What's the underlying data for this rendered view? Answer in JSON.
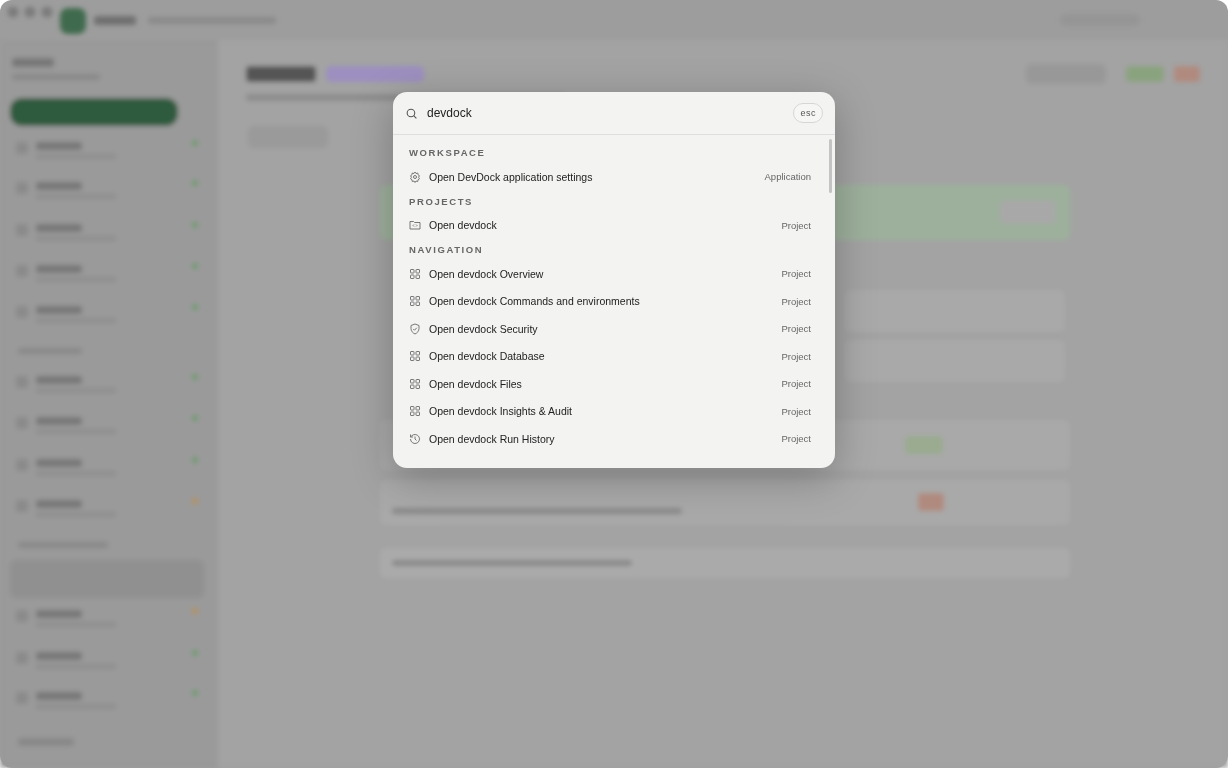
{
  "search": {
    "value": "devdock"
  },
  "esc_key": "esc",
  "sections": [
    {
      "title": "WORKSPACE",
      "items": [
        {
          "kind": "settings",
          "label": "Open DevDock application settings",
          "tag": "Application"
        }
      ]
    },
    {
      "title": "PROJECTS",
      "items": [
        {
          "kind": "folder",
          "label": "Open devdock",
          "tag": "Project"
        }
      ]
    },
    {
      "title": "NAVIGATION",
      "items": [
        {
          "kind": "page",
          "label": "Open devdock Overview",
          "tag": "Project"
        },
        {
          "kind": "page",
          "label": "Open devdock Commands and environments",
          "tag": "Project"
        },
        {
          "kind": "security",
          "label": "Open devdock Security",
          "tag": "Project"
        },
        {
          "kind": "page",
          "label": "Open devdock Database",
          "tag": "Project"
        },
        {
          "kind": "page",
          "label": "Open devdock Files",
          "tag": "Project"
        },
        {
          "kind": "page",
          "label": "Open devdock Insights & Audit",
          "tag": "Project"
        },
        {
          "kind": "history",
          "label": "Open devdock Run History",
          "tag": "Project"
        }
      ]
    }
  ]
}
